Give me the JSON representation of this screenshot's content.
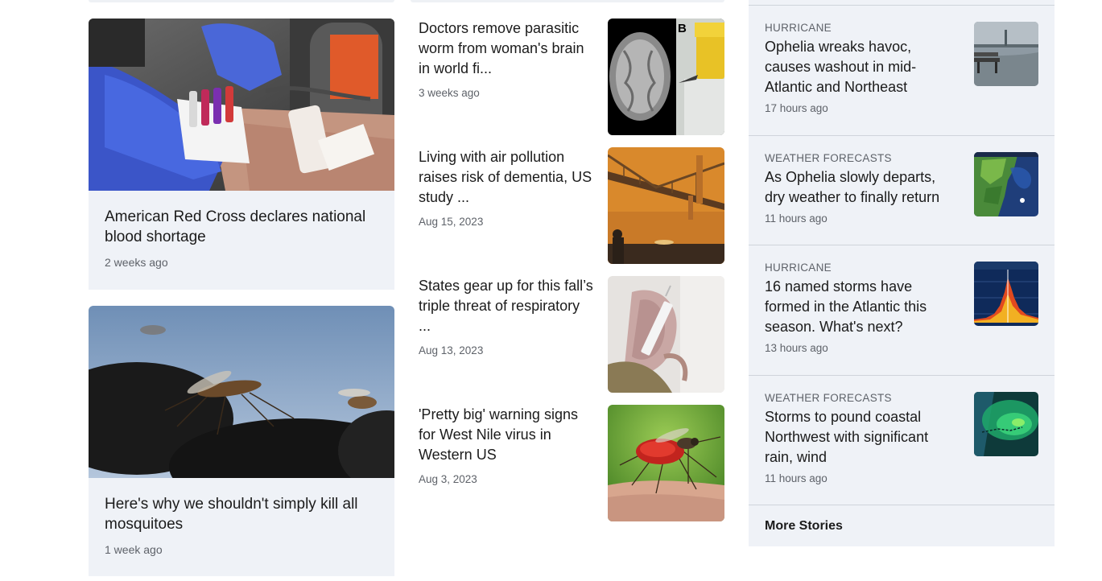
{
  "left_cards": [
    {
      "title": "American Red Cross declares national blood shortage",
      "time": "2 weeks ago",
      "image_icon": "blood-donation-image"
    },
    {
      "title": "Here's why we shouldn't simply kill all mosquitoes",
      "time": "1 week ago",
      "image_icon": "mosquitoes-image"
    }
  ],
  "mid_items": [
    {
      "title": "Doctors remove parasitic worm from woman's brain in world fi...",
      "time": "3 weeks ago",
      "image_icon": "brain-scan-image",
      "image_label": "B"
    },
    {
      "title": "Living with air pollution raises risk of dementia, US study ...",
      "time": "Aug 15, 2023",
      "image_icon": "smoggy-bridge-image"
    },
    {
      "title": "States gear up for this fall’s triple threat of respiratory ...",
      "time": "Aug 13, 2023",
      "image_icon": "vaccine-syringe-image"
    },
    {
      "title": "'Pretty big' warning signs for West Nile virus in Western US",
      "time": "Aug 3, 2023",
      "image_icon": "mosquito-skin-image"
    }
  ],
  "right_items": [
    {
      "category": "HURRICANE",
      "title": "Ophelia wreaks havoc, causes washout in mid-Atlantic and Northeast",
      "time": "17 hours ago",
      "image_icon": "flooded-bench-image"
    },
    {
      "category": "WEATHER FORECASTS",
      "title": "As Ophelia slowly departs, dry weather to finally return",
      "time": "11 hours ago",
      "image_icon": "weather-map-image"
    },
    {
      "category": "HURRICANE",
      "title": "16 named storms have formed in the Atlantic this season. What's next?",
      "time": "13 hours ago",
      "image_icon": "storm-chart-image"
    },
    {
      "category": "WEATHER FORECASTS",
      "title": "Storms to pound coastal Northwest with significant rain, wind",
      "time": "11 hours ago",
      "image_icon": "radar-map-image"
    }
  ],
  "more_stories_label": "More Stories",
  "colors": {
    "panel_bg": "#eff2f7",
    "divider": "#cfd4db",
    "meta_text": "#5e6269",
    "title_text": "#1b1b1b"
  }
}
